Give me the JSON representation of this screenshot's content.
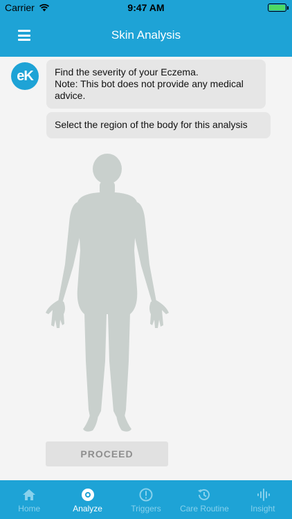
{
  "status_bar": {
    "carrier": "Carrier",
    "time": "9:47 AM"
  },
  "nav": {
    "title": "Skin Analysis"
  },
  "bot": {
    "avatar_text": "eK"
  },
  "messages": [
    {
      "lines": [
        "Find the severity of your Eczema.",
        "Note: This bot does not provide any medical advice."
      ]
    },
    {
      "text": "Select the region of the body for this analysis"
    }
  ],
  "proceed_label": "PROCEED",
  "tabs": [
    {
      "label": "Home",
      "icon": "home-icon",
      "active": false
    },
    {
      "label": "Analyze",
      "icon": "analyze-icon",
      "active": true
    },
    {
      "label": "Triggers",
      "icon": "alert-icon",
      "active": false
    },
    {
      "label": "Care Routine",
      "icon": "history-icon",
      "active": false
    },
    {
      "label": "Insight",
      "icon": "waveform-icon",
      "active": false
    }
  ],
  "colors": {
    "primary": "#1ea3d6",
    "bubble": "#e6e6e6",
    "silhouette": "#c9d0cd",
    "chat_bg": "#f4f4f4"
  }
}
